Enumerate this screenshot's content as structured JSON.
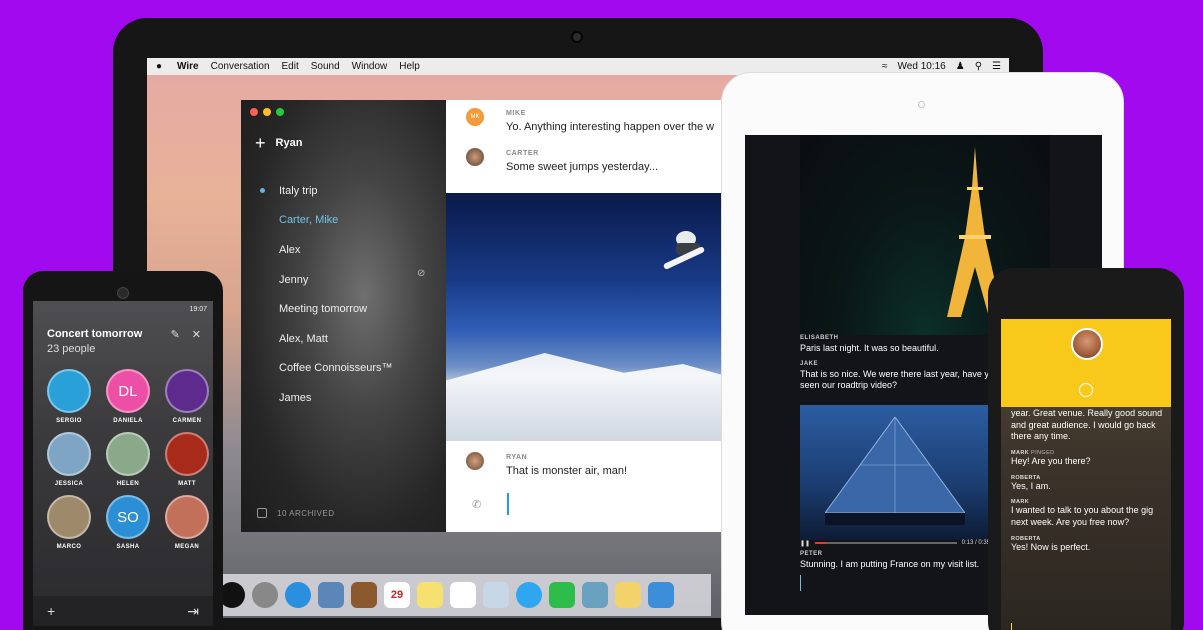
{
  "colors": {
    "background": "#a10aee",
    "accent": "#2b9cd8",
    "highlight": "#f8c91b"
  },
  "laptop": {
    "menubar": {
      "apple_icon": "apple-icon",
      "items": [
        "Wire",
        "Conversation",
        "Edit",
        "Sound",
        "Window",
        "Help"
      ],
      "clock": "Wed 10:16"
    },
    "sidebar": {
      "user": "Ryan",
      "conversations": [
        "Italy trip",
        "Carter, Mike",
        "Alex",
        "Jenny",
        "Meeting tomorrow",
        "Alex, Matt",
        "Coffee Connoisseurs™",
        "James"
      ],
      "archived_label": "10 ARCHIVED"
    },
    "chat": {
      "messages": [
        {
          "sender": "MIKE",
          "avatar": "MK",
          "text": "Yo. Anything interesting happen over the w"
        },
        {
          "sender": "CARTER",
          "avatar": "",
          "text": "Some sweet jumps yesterday..."
        },
        {
          "sender": "RYAN",
          "avatar": "",
          "text": "That is monster air, man!"
        }
      ]
    },
    "dock_calendar_day": "29"
  },
  "tablet": {
    "messages": [
      {
        "sender": "ELISABETH",
        "text": "Paris last night. It was so beautiful."
      },
      {
        "sender": "JAKE",
        "text": "That is so nice. We were there last year, have you seen our roadtrip video?"
      }
    ],
    "video_time": "0:13 / 0:35",
    "last_message": {
      "sender": "PETER",
      "text": "Stunning. I am putting France on my visit list."
    }
  },
  "android": {
    "time": "19:07",
    "title": "Concert tomorrow",
    "subtitle": "23 people",
    "people": [
      {
        "name": "SERGIO",
        "initials": "",
        "color": "#2aa0d8"
      },
      {
        "name": "DANIELA",
        "initials": "DL",
        "color": "#ee4fa6"
      },
      {
        "name": "CARMEN",
        "initials": "",
        "color": "#5d2a8d"
      },
      {
        "name": "JESSICA",
        "initials": "",
        "color": "#7fa5c4"
      },
      {
        "name": "HELEN",
        "initials": "",
        "color": "#8aa88a"
      },
      {
        "name": "MATT",
        "initials": "",
        "color": "#a82a1a"
      },
      {
        "name": "MARCO",
        "initials": "",
        "color": "#9c8a6a"
      },
      {
        "name": "SASHA",
        "initials": "SO",
        "color": "#2b8fd6"
      },
      {
        "name": "MEGAN",
        "initials": "",
        "color": "#c2705a"
      }
    ]
  },
  "iphone": {
    "messages": [
      {
        "sender": "",
        "text": "year. Great venue. Really good sound and great audience. I would go back there any time."
      },
      {
        "sender": "MARK",
        "note": "PINGED",
        "text": "Hey! Are you there?"
      },
      {
        "sender": "ROBERTA",
        "note": "",
        "text": "Yes, I am."
      },
      {
        "sender": "MARK",
        "note": "",
        "text": "I wanted to talk to you about the gig next week. Are you free now?"
      },
      {
        "sender": "ROBERTA",
        "note": "",
        "text": "Yes! Now is perfect."
      }
    ]
  }
}
